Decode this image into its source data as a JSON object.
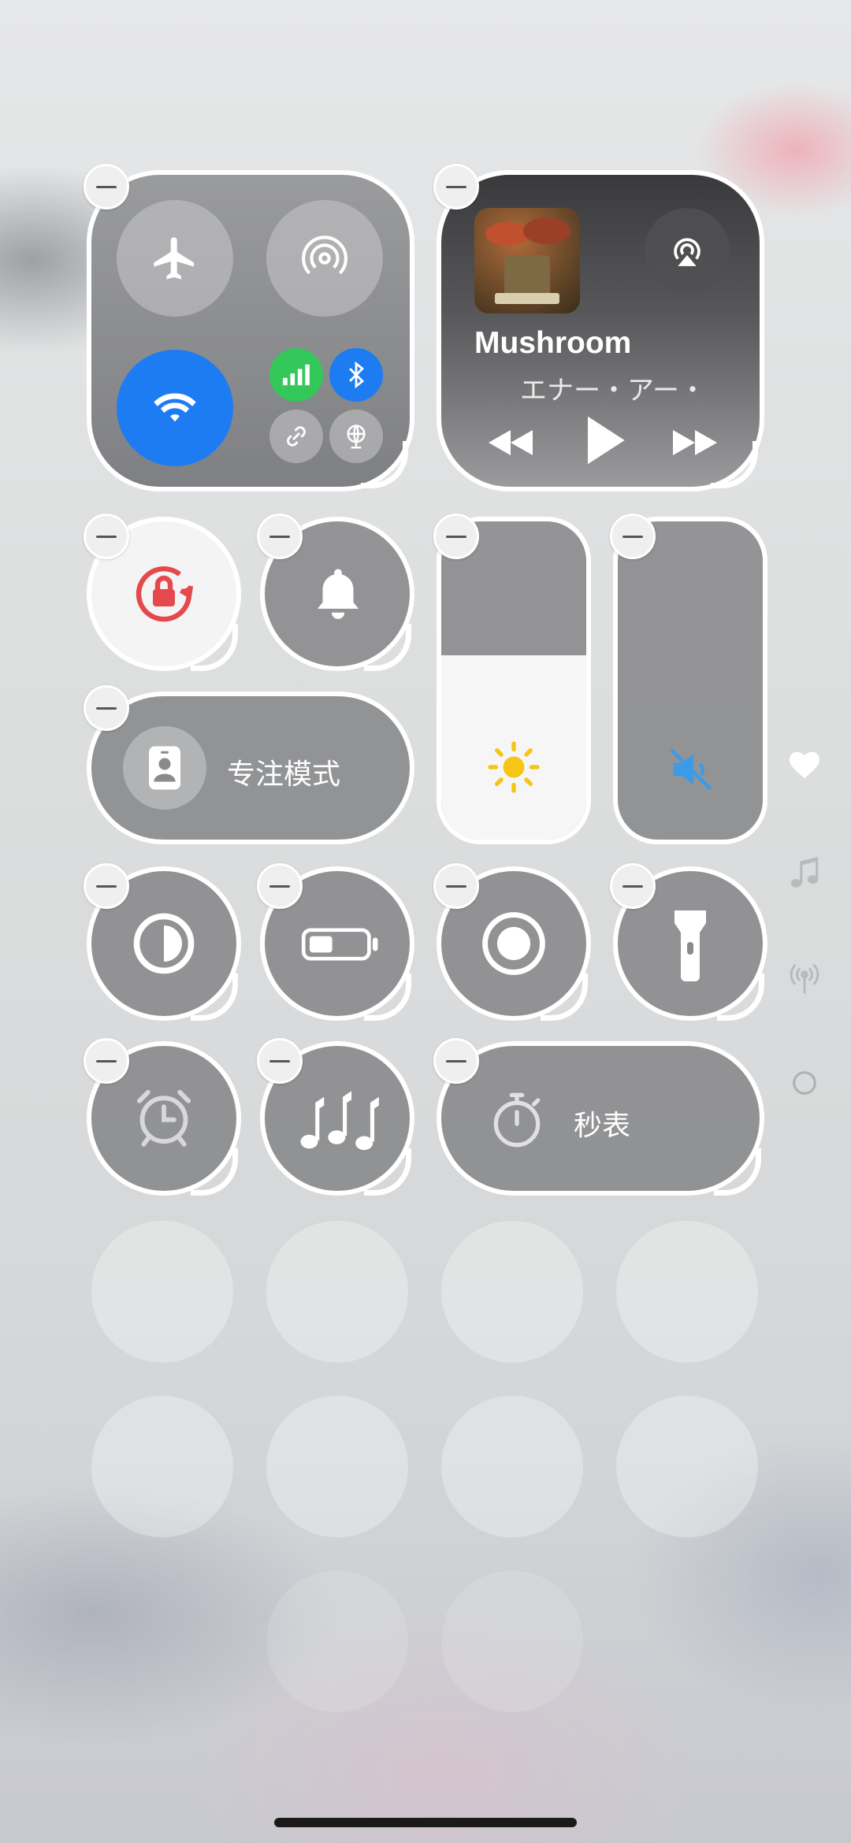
{
  "connectivity": {
    "airplane": "airplane-icon",
    "airdrop": "airdrop-icon",
    "wifi": "wifi-icon",
    "cellular": "cellular-icon",
    "bluetooth": "bluetooth-icon",
    "chain": "personal-hotspot-icon",
    "vpn": "globe-icon",
    "wifi_color": "#1E7CF2",
    "cellular_color": "#34C759",
    "bluetooth_color": "#1E7CF2"
  },
  "media": {
    "title": "Mushroom",
    "artist": "エナー・アー・"
  },
  "focus": {
    "label": "专注模式"
  },
  "stopwatch": {
    "label": "秒表"
  },
  "brightness": {
    "level": 0.58
  },
  "volume": {
    "muted": true,
    "level": 0.0
  },
  "colors": {
    "rotation_lock": "#E5484D",
    "sun": "#F5C518",
    "mute": "#3A9BE8"
  }
}
